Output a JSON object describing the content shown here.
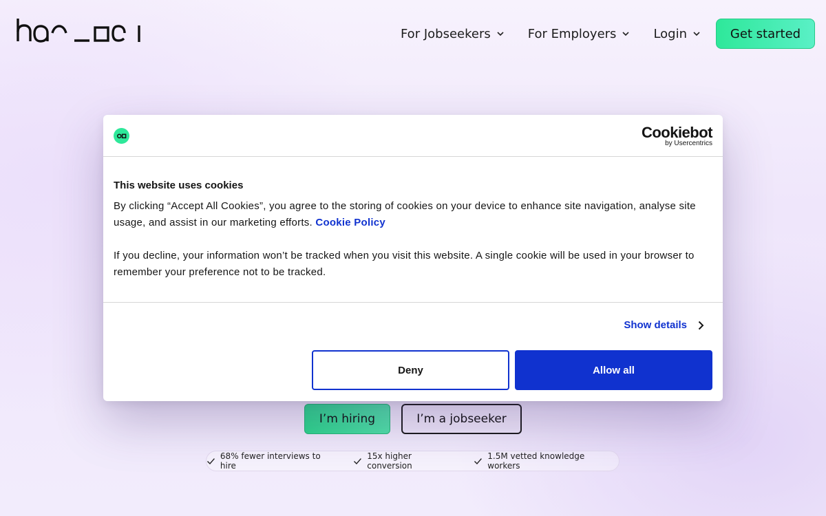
{
  "header": {
    "logo_text": "hacoca",
    "nav": [
      {
        "label": "For Jobseekers",
        "icon": "chevron-down-icon"
      },
      {
        "label": "For Employers",
        "icon": "chevron-down-icon"
      },
      {
        "label": "Login",
        "icon": "chevron-down-icon"
      }
    ],
    "cta_label": "Get started"
  },
  "hero": {
    "hire_label": "I’m hiring",
    "jobseeker_label": "I’m a jobseeker",
    "stats": [
      "68% fewer interviews to hire",
      "15x higher conversion",
      "1.5M vetted knowledge workers"
    ]
  },
  "cookie_dialog": {
    "brand_word": "Cookiebot",
    "brand_sub": "by Usercentrics",
    "title": "This website uses cookies",
    "paragraph1": "By clicking “Accept All Cookies”, you agree to the storing of cookies on your device to enhance site navigation, analyse site usage, and assist in our marketing efforts.",
    "policy_link": "Cookie Policy",
    "paragraph2": "If you decline, your information won’t be tracked when you visit this website. A single cookie will be used in your browser to remember your preference not to be tracked.",
    "show_details": "Show details",
    "deny_label": "Deny",
    "allow_label": "Allow all"
  },
  "colors": {
    "accent_blue": "#1032cf",
    "brand_green": "#2ee89a",
    "text_dark": "#141414"
  }
}
